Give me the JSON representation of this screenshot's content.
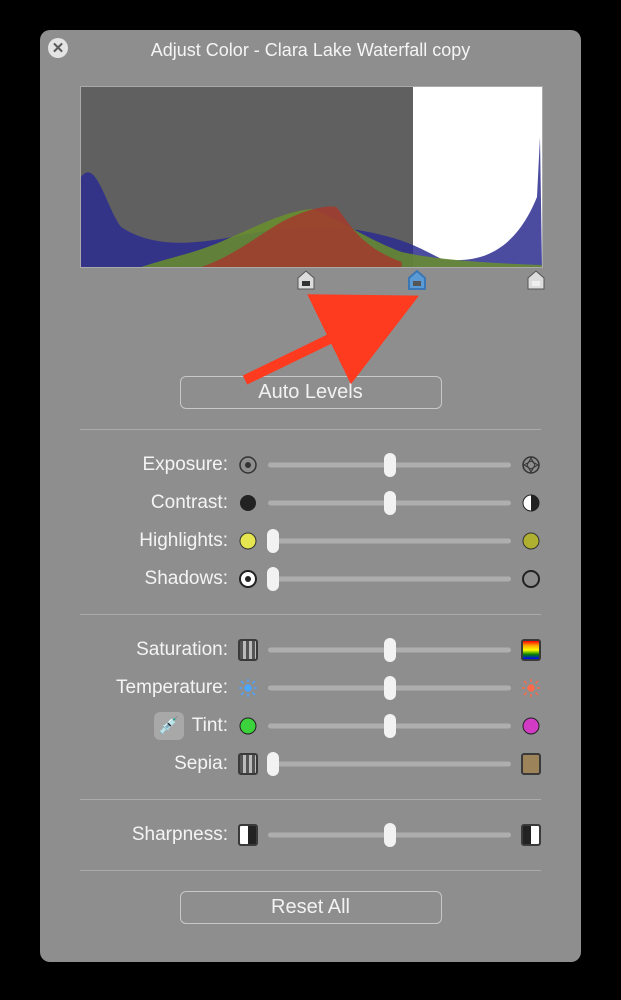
{
  "window": {
    "title": "Adjust Color - Clara Lake Waterfall copy"
  },
  "histogram": {
    "light_start_pct": 72,
    "markers": {
      "black": 49,
      "mid": 73,
      "white": 99
    }
  },
  "buttons": {
    "auto_levels": "Auto Levels",
    "reset_all": "Reset All"
  },
  "groups": [
    {
      "rows": [
        {
          "key": "exposure",
          "label": "Exposure:",
          "value": 50,
          "left_icon": "aperture-closed-icon",
          "right_icon": "aperture-open-icon"
        },
        {
          "key": "contrast",
          "label": "Contrast:",
          "value": 50,
          "left_icon": "contrast-low-icon",
          "right_icon": "contrast-high-icon"
        },
        {
          "key": "highlights",
          "label": "Highlights:",
          "value": 2,
          "left_icon": "highlight-low-icon",
          "right_icon": "highlight-high-icon"
        },
        {
          "key": "shadows",
          "label": "Shadows:",
          "value": 2,
          "left_icon": "shadow-low-icon",
          "right_icon": "shadow-high-icon"
        }
      ]
    },
    {
      "rows": [
        {
          "key": "saturation",
          "label": "Saturation:",
          "value": 50,
          "left_icon": "stripes-icon",
          "right_icon": "rainbow-icon"
        },
        {
          "key": "temperature",
          "label": "Temperature:",
          "value": 50,
          "left_icon": "temp-cool-icon",
          "right_icon": "temp-warm-icon"
        },
        {
          "key": "tint",
          "label": "Tint:",
          "value": 50,
          "left_icon": "tint-green-icon",
          "right_icon": "tint-magenta-icon",
          "prefix": "eyedropper"
        },
        {
          "key": "sepia",
          "label": "Sepia:",
          "value": 2,
          "left_icon": "stripes-icon",
          "right_icon": "sepia-icon"
        }
      ]
    },
    {
      "rows": [
        {
          "key": "sharpness",
          "label": "Sharpness:",
          "value": 50,
          "left_icon": "sharp-low-icon",
          "right_icon": "sharp-high-icon"
        }
      ]
    }
  ]
}
